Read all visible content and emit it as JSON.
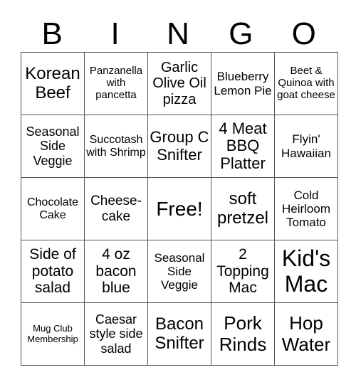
{
  "header": {
    "letters": [
      "B",
      "I",
      "N",
      "G",
      "O"
    ]
  },
  "board": {
    "rows": [
      [
        "Korean Beef",
        "Panzanella with pancetta",
        "Garlic Olive Oil pizza",
        "Blueberry Lemon Pie",
        "Beet & Quinoa with goat cheese"
      ],
      [
        "Seasonal Side Veggie",
        "Succotash with Shrimp",
        "Group C Snifter",
        "4 Meat BBQ Platter",
        "Flyin' Hawaiian"
      ],
      [
        "Chocolate Cake",
        "Cheese-cake",
        "Free!",
        "soft pretzel",
        "Cold Heirloom Tomato"
      ],
      [
        "Side of potato salad",
        "4 oz bacon blue",
        "Seasonal Side Veggie",
        "2 Topping Mac",
        "Kid's Mac"
      ],
      [
        "Mug Club Membership",
        "Caesar style side salad",
        "Bacon Snifter",
        "Pork Rinds",
        "Hop Water"
      ]
    ]
  },
  "colors": {
    "text": "#000000",
    "grid_line": "#555555",
    "background": "#ffffff"
  }
}
